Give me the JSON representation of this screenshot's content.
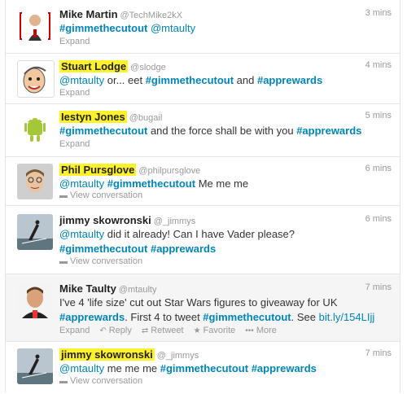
{
  "tweets": [
    {
      "name": "Mike Martin",
      "handle": "@TechMike2kX",
      "time": "3 mins",
      "parts": [
        {
          "t": "#gimmethecutout",
          "k": "tag"
        },
        {
          "t": " ",
          "k": "txt"
        },
        {
          "t": "@mtaulty",
          "k": "link"
        }
      ],
      "actions": [
        "Expand"
      ],
      "highlight": false,
      "avatar": "mike-martin"
    },
    {
      "name": "Stuart Lodge",
      "handle": "@slodge",
      "time": "4 mins",
      "parts": [
        {
          "t": "@mtaulty",
          "k": "link"
        },
        {
          "t": " or... eet ",
          "k": "txt"
        },
        {
          "t": "#gimmethecutout",
          "k": "tag"
        },
        {
          "t": " and ",
          "k": "txt"
        },
        {
          "t": "#apprewards",
          "k": "tag"
        }
      ],
      "actions": [
        "Expand"
      ],
      "highlight": true,
      "avatar": "stuart-lodge"
    },
    {
      "name": "Iestyn Jones",
      "handle": "@bugail",
      "time": "5 mins",
      "parts": [
        {
          "t": "#gimmethecutout",
          "k": "tag"
        },
        {
          "t": " and the force shall be with you ",
          "k": "txt"
        },
        {
          "t": "#apprewards",
          "k": "tag"
        }
      ],
      "actions": [
        "Expand"
      ],
      "highlight": true,
      "avatar": "iestyn-jones"
    },
    {
      "name": "Phil Pursglove",
      "handle": "@philpursglove",
      "time": "6 mins",
      "parts": [
        {
          "t": "@mtaulty",
          "k": "link"
        },
        {
          "t": " ",
          "k": "txt"
        },
        {
          "t": "#gimmethecutout",
          "k": "tag"
        },
        {
          "t": " Me me me",
          "k": "txt"
        }
      ],
      "actions": [
        "View conversation"
      ],
      "highlight": true,
      "avatar": "phil-pursglove"
    },
    {
      "name": "jimmy skowronski",
      "handle": "@_jimmys",
      "time": "6 mins",
      "parts": [
        {
          "t": "@mtaulty",
          "k": "link"
        },
        {
          "t": " did it already! Can I have Vader please?",
          "k": "txt"
        },
        {
          "t": "\n",
          "k": "br"
        },
        {
          "t": "#gimmethecutout",
          "k": "tag"
        },
        {
          "t": " ",
          "k": "txt"
        },
        {
          "t": "#apprewards",
          "k": "tag"
        }
      ],
      "actions": [
        "View conversation"
      ],
      "highlight": false,
      "avatar": "jimmy-skowronski"
    },
    {
      "name": "Mike Taulty",
      "handle": "@mtaulty",
      "time": "7 mins",
      "parts": [
        {
          "t": "I've 4 'life size' cut out Star Wars figures to giveaway for UK",
          "k": "txt"
        },
        {
          "t": "\n",
          "k": "br"
        },
        {
          "t": "#apprewards",
          "k": "tag"
        },
        {
          "t": ". First 4 to tweet ",
          "k": "txt"
        },
        {
          "t": "#gimmethecutout",
          "k": "tag"
        },
        {
          "t": ". See ",
          "k": "txt"
        },
        {
          "t": "bit.ly/154LIjj",
          "k": "link"
        }
      ],
      "actions": [
        "Expand",
        "Reply",
        "Retweet",
        "Favorite",
        "More"
      ],
      "highlight": false,
      "avatar": "mike-taulty"
    },
    {
      "name": "jimmy skowronski",
      "handle": "@_jimmys",
      "time": "7 mins",
      "parts": [
        {
          "t": "@mtaulty",
          "k": "link"
        },
        {
          "t": " me me me ",
          "k": "txt"
        },
        {
          "t": "#gimmethecutout",
          "k": "tag"
        },
        {
          "t": " ",
          "k": "txt"
        },
        {
          "t": "#apprewards",
          "k": "tag"
        }
      ],
      "actions": [
        "View conversation"
      ],
      "highlight": true,
      "avatar": "jimmy-skowronski"
    }
  ]
}
